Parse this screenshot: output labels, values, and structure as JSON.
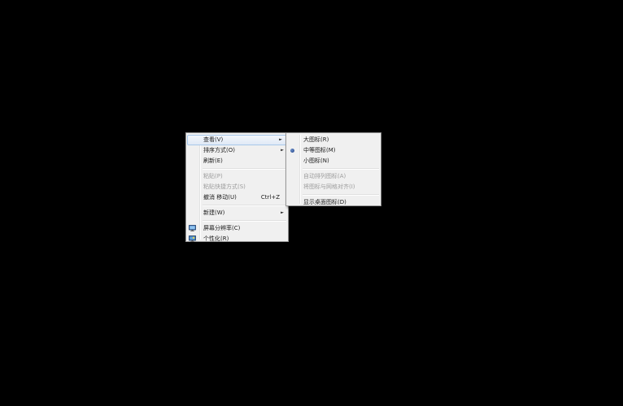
{
  "context_menu": {
    "items": [
      {
        "label": "查看(V)"
      },
      {
        "label": "排序方式(O)"
      },
      {
        "label": "刷新(E)"
      },
      {
        "label": "粘贴(P)"
      },
      {
        "label": "粘贴快捷方式(S)"
      },
      {
        "label": "撤消 移动(U)",
        "shortcut": "Ctrl+Z"
      },
      {
        "label": "新建(W)"
      },
      {
        "label": "屏幕分辨率(C)",
        "icon": "display-icon"
      },
      {
        "label": "个性化(R)",
        "icon": "personalize-icon"
      }
    ],
    "submenu_arrow": "►"
  },
  "view_submenu": {
    "items": [
      {
        "label": "大图标(R)"
      },
      {
        "label": "中等图标(M)",
        "checked": true
      },
      {
        "label": "小图标(N)"
      },
      {
        "label": "自动排列图标(A)"
      },
      {
        "label": "将图标与网格对齐(I)"
      },
      {
        "label": "显示桌面图标(D)"
      }
    ]
  },
  "colors": {
    "desktop": "#000000",
    "menu_bg": "#f0f0f0",
    "highlight_border": "#a8c8ea",
    "disabled_text": "#9c9c9c"
  }
}
